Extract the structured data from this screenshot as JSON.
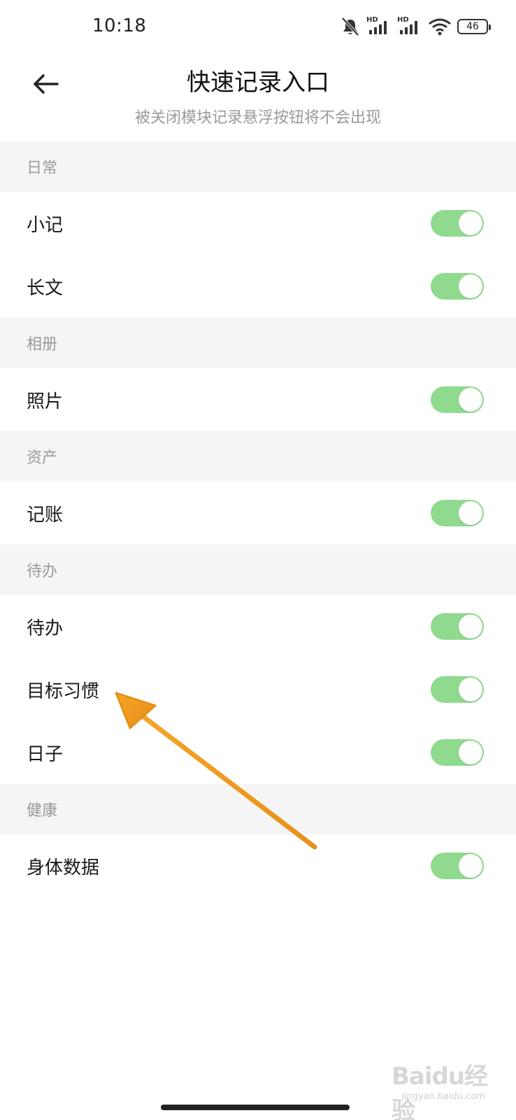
{
  "status_bar": {
    "time": "10:18",
    "battery": "46",
    "icons": [
      "mute-icon",
      "hd-signal-icon",
      "hd-signal-icon",
      "wifi-icon",
      "battery-icon"
    ],
    "hd_label": "HD"
  },
  "header": {
    "title": "快速记录入口",
    "subtitle": "被关闭模块记录悬浮按钮将不会出现",
    "back_icon": "arrow-left-icon"
  },
  "sections": [
    {
      "title": "日常",
      "items": [
        {
          "label": "小记",
          "enabled": true
        },
        {
          "label": "长文",
          "enabled": true
        }
      ]
    },
    {
      "title": "相册",
      "items": [
        {
          "label": "照片",
          "enabled": true
        }
      ]
    },
    {
      "title": "资产",
      "items": [
        {
          "label": "记账",
          "enabled": true
        }
      ]
    },
    {
      "title": "待办",
      "items": [
        {
          "label": "待办",
          "enabled": true
        },
        {
          "label": "目标习惯",
          "enabled": true
        },
        {
          "label": "日子",
          "enabled": true
        }
      ]
    },
    {
      "title": "健康",
      "items": [
        {
          "label": "身体数据",
          "enabled": true
        }
      ]
    }
  ],
  "colors": {
    "toggle_on": "#8fda8f",
    "section_bg": "#f5f5f5",
    "annotation_arrow": "#f0a020"
  },
  "watermark": {
    "logo": "Baidu经验",
    "url": "jingyan.baidu.com"
  }
}
